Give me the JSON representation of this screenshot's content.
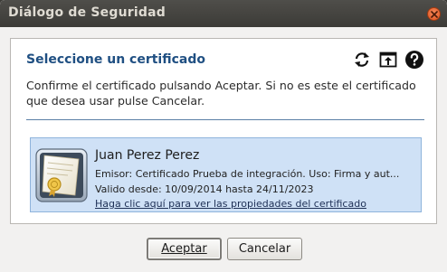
{
  "window": {
    "title": "Diálogo de Seguridad"
  },
  "panel": {
    "heading": "Seleccione un certificado",
    "description": "Confirme el certificado pulsando Aceptar. Si no es este el certificado que desea usar pulse Cancelar.",
    "icons": [
      "refresh-icon",
      "open-file-icon",
      "help-icon"
    ]
  },
  "certificate": {
    "name": "Juan Perez Perez",
    "issuer": "Emisor: Certificado Prueba de integración. Uso: Firma y aut...",
    "validity": "Valido desde: 10/09/2014 hasta 24/11/2023",
    "link": "Haga clic aquí para ver las propiedades del certificado"
  },
  "buttons": {
    "accept": "Aceptar",
    "cancel": "Cancelar"
  },
  "colors": {
    "heading": "#1f4f82",
    "card_background": "#cfe1f6",
    "close_button": "#e0521f",
    "titlebar": "#3c3b37"
  }
}
